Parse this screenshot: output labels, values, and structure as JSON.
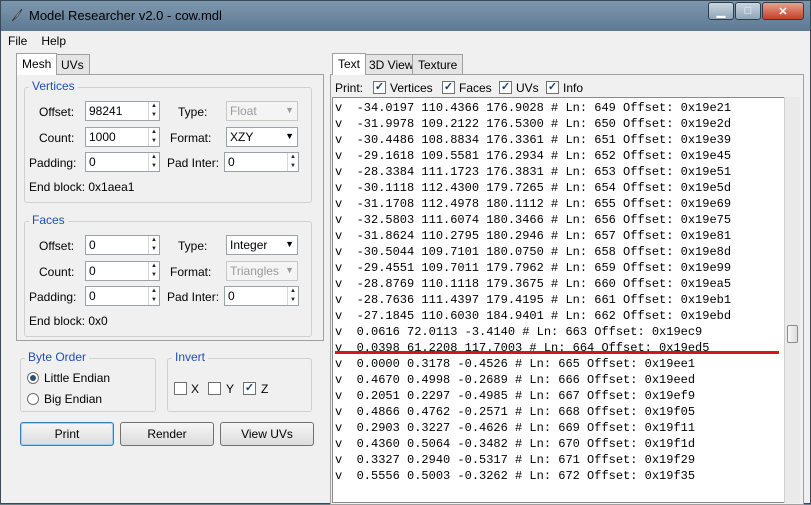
{
  "window": {
    "title": "Model Researcher v2.0 - cow.mdl"
  },
  "menu": [
    "File",
    "Help"
  ],
  "left_tabs": [
    "Mesh",
    "UVs"
  ],
  "vertices": {
    "group_title": "Vertices",
    "offset_label": "Offset:",
    "offset_value": "98241",
    "type_label": "Type:",
    "type_value": "Float",
    "count_label": "Count:",
    "count_value": "1000",
    "format_label": "Format:",
    "format_value": "XZY",
    "padding_label": "Padding:",
    "padding_value": "0",
    "padinter_label": "Pad Inter:",
    "padinter_value": "0",
    "end_block": "End block: 0x1aea1"
  },
  "faces": {
    "group_title": "Faces",
    "offset_label": "Offset:",
    "offset_value": "0",
    "type_label": "Type:",
    "type_value": "Integer",
    "count_label": "Count:",
    "count_value": "0",
    "format_label": "Format:",
    "format_value": "Triangles",
    "padding_label": "Padding:",
    "padding_value": "0",
    "padinter_label": "Pad Inter:",
    "padinter_value": "0",
    "end_block": "End block: 0x0"
  },
  "byte_order": {
    "title": "Byte Order",
    "options": [
      "Little Endian",
      "Big Endian"
    ],
    "selected": "Little Endian"
  },
  "invert": {
    "title": "Invert",
    "x": "X",
    "y": "Y",
    "z": "Z"
  },
  "buttons": {
    "print": "Print",
    "render": "Render",
    "view_uvs": "View UVs"
  },
  "right_tabs": [
    "Text",
    "3D View",
    "Texture"
  ],
  "print_opts": {
    "label": "Print:",
    "vertices": "Vertices",
    "faces": "Faces",
    "uvs": "UVs",
    "info": "Info"
  },
  "text_lines": [
    "v  -34.0197 110.4366 176.9028 # Ln: 649 Offset: 0x19e21",
    "v  -31.9978 109.2122 176.5300 # Ln: 650 Offset: 0x19e2d",
    "v  -30.4486 108.8834 176.3361 # Ln: 651 Offset: 0x19e39",
    "v  -29.1618 109.5581 176.2934 # Ln: 652 Offset: 0x19e45",
    "v  -28.3384 111.1723 176.3831 # Ln: 653 Offset: 0x19e51",
    "v  -30.1118 112.4300 179.7265 # Ln: 654 Offset: 0x19e5d",
    "v  -31.1708 112.4978 180.1112 # Ln: 655 Offset: 0x19e69",
    "v  -32.5803 111.6074 180.3466 # Ln: 656 Offset: 0x19e75",
    "v  -31.8624 110.2795 180.2946 # Ln: 657 Offset: 0x19e81",
    "v  -30.5044 109.7101 180.0750 # Ln: 658 Offset: 0x19e8d",
    "v  -29.4551 109.7011 179.7962 # Ln: 659 Offset: 0x19e99",
    "v  -28.8769 110.1118 179.3675 # Ln: 660 Offset: 0x19ea5",
    "v  -28.7636 111.4397 179.4195 # Ln: 661 Offset: 0x19eb1",
    "v  -27.1845 110.6030 184.9401 # Ln: 662 Offset: 0x19ebd",
    "v  0.0616 72.0113 -3.4140 # Ln: 663 Offset: 0x19ec9",
    "v  0.0398 61.2208 117.7003 # Ln: 664 Offset: 0x19ed5",
    "v  0.0000 0.3178 -0.4526 # Ln: 665 Offset: 0x19ee1",
    "v  0.4670 0.4998 -0.2689 # Ln: 666 Offset: 0x19eed",
    "v  0.2051 0.2297 -0.4985 # Ln: 667 Offset: 0x19ef9",
    "v  0.4866 0.4762 -0.2571 # Ln: 668 Offset: 0x19f05",
    "v  0.2903 0.3227 -0.4626 # Ln: 669 Offset: 0x19f11",
    "v  0.4360 0.5064 -0.3482 # Ln: 670 Offset: 0x19f1d",
    "v  0.3327 0.2940 -0.5317 # Ln: 671 Offset: 0x19f29",
    "v  0.5556 0.5003 -0.3262 # Ln: 672 Offset: 0x19f35"
  ],
  "colors": {
    "highlight_line": "#d8141b",
    "group_title": "#1f4faf"
  }
}
